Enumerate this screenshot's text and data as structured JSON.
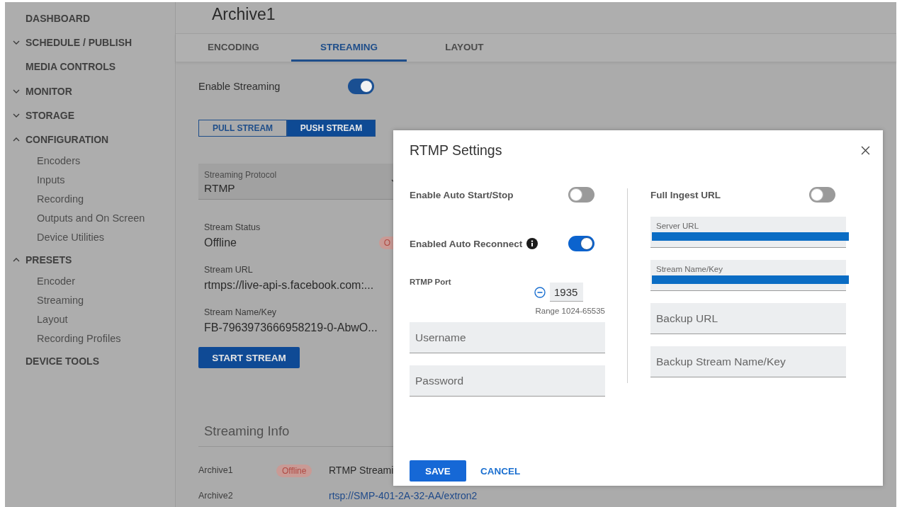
{
  "sidebar": {
    "items": [
      {
        "kind": "link",
        "label": "DASHBOARD"
      },
      {
        "kind": "group",
        "label": "SCHEDULE / PUBLISH",
        "expanded": false
      },
      {
        "kind": "link",
        "label": "MEDIA CONTROLS"
      },
      {
        "kind": "group",
        "label": "MONITOR",
        "expanded": false
      },
      {
        "kind": "group",
        "label": "STORAGE",
        "expanded": false
      },
      {
        "kind": "group",
        "label": "CONFIGURATION",
        "expanded": true,
        "children": [
          "Encoders",
          "Inputs",
          "Recording",
          "Outputs and On Screen",
          "Device Utilities"
        ]
      },
      {
        "kind": "group",
        "label": "PRESETS",
        "expanded": true,
        "children": [
          "Encoder",
          "Streaming",
          "Layout",
          "Recording Profiles"
        ]
      },
      {
        "kind": "link",
        "label": "DEVICE TOOLS"
      }
    ]
  },
  "page": {
    "title": "Archive1",
    "tabs": [
      {
        "label": "ENCODING",
        "selected": false
      },
      {
        "label": "STREAMING",
        "selected": true
      },
      {
        "label": "LAYOUT",
        "selected": false
      }
    ],
    "enable_streaming": {
      "label": "Enable Streaming",
      "on": true
    },
    "stream_modes": [
      {
        "label": "PULL STREAM",
        "selected": false
      },
      {
        "label": "PUSH STREAM",
        "selected": true
      }
    ],
    "protocol": {
      "label": "Streaming Protocol",
      "value": "RTMP"
    },
    "stream_status": {
      "label": "Stream Status",
      "value": "Offline",
      "badge": "O"
    },
    "stream_url": {
      "label": "Stream URL",
      "value": "rtmps://live-api-s.facebook.com:..."
    },
    "stream_key": {
      "label": "Stream Name/Key",
      "value": "FB-7963973666958219-0-AbwO..."
    },
    "start_button": "START STREAM",
    "streaming_info": {
      "title": "Streaming Info",
      "rows": [
        {
          "name": "Archive1",
          "status": "Offline",
          "kind": "text",
          "detail": "RTMP Streami"
        },
        {
          "name": "Archive2",
          "kind": "link",
          "detail": "rtsp://SMP-401-2A-32-AA/extron2"
        }
      ]
    }
  },
  "dialog": {
    "title": "RTMP Settings",
    "left": {
      "auto_start": {
        "label": "Enable Auto Start/Stop",
        "on": false
      },
      "auto_reconnect": {
        "label": "Enabled Auto Reconnect",
        "on": true
      },
      "port": {
        "label": "RTMP Port",
        "value": "1935",
        "range": "Range 1024-65535"
      },
      "fields": [
        {
          "placeholder": "Username"
        },
        {
          "placeholder": "Password"
        }
      ]
    },
    "right": {
      "full_ingest": {
        "label": "Full Ingest URL",
        "on": false
      },
      "fields": [
        {
          "label": "Server URL",
          "redacted": true
        },
        {
          "label": "Stream Name/Key",
          "redacted": true
        },
        {
          "placeholder": "Backup URL"
        },
        {
          "placeholder": "Backup Stream Name/Key"
        }
      ]
    },
    "buttons": [
      {
        "kind": "primary",
        "label": "SAVE"
      },
      {
        "kind": "text",
        "label": "CANCEL"
      }
    ]
  }
}
